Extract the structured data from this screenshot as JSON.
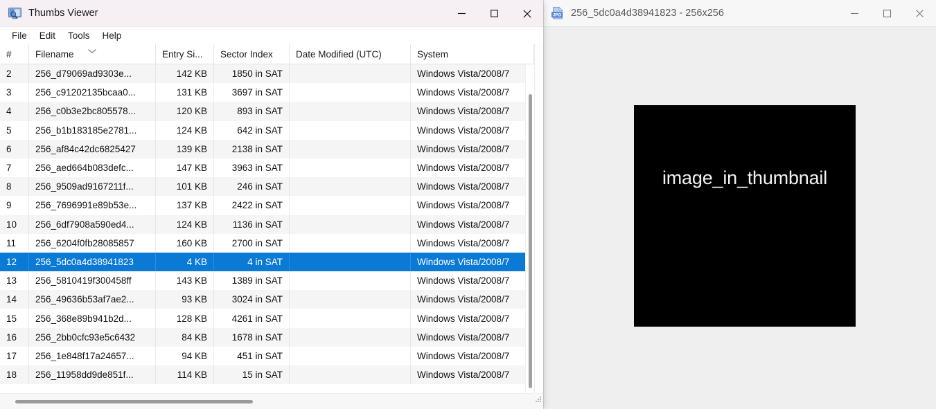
{
  "main_window": {
    "title": "Thumbs Viewer",
    "app_icon": "monitor-magnifier-icon",
    "menu": [
      {
        "label": "File"
      },
      {
        "label": "Edit"
      },
      {
        "label": "Tools"
      },
      {
        "label": "Help"
      }
    ],
    "window_controls": {
      "minimize": "minimize-icon",
      "maximize": "maximize-icon",
      "close": "close-icon"
    },
    "list": {
      "sort_column": "Filename",
      "sort_direction": "descending",
      "selected_row_index": 12,
      "selection_color": "#0b7ad4",
      "columns": [
        {
          "key": "index",
          "label": "#"
        },
        {
          "key": "filename",
          "label": "Filename"
        },
        {
          "key": "entry_size",
          "label": "Entry Si..."
        },
        {
          "key": "sector_index",
          "label": "Sector Index"
        },
        {
          "key": "date_modified",
          "label": "Date Modified (UTC)"
        },
        {
          "key": "system",
          "label": "System"
        }
      ],
      "rows": [
        {
          "index": "2",
          "filename": "256_d79069ad9303e...",
          "entry_size": "142 KB",
          "sector_index": "1850 in SAT",
          "date_modified": "",
          "system": "Windows Vista/2008/7"
        },
        {
          "index": "3",
          "filename": "256_c91202135bcaa0...",
          "entry_size": "131 KB",
          "sector_index": "3697 in SAT",
          "date_modified": "",
          "system": "Windows Vista/2008/7"
        },
        {
          "index": "4",
          "filename": "256_c0b3e2bc805578...",
          "entry_size": "120 KB",
          "sector_index": "893 in SAT",
          "date_modified": "",
          "system": "Windows Vista/2008/7"
        },
        {
          "index": "5",
          "filename": "256_b1b183185e2781...",
          "entry_size": "124 KB",
          "sector_index": "642 in SAT",
          "date_modified": "",
          "system": "Windows Vista/2008/7"
        },
        {
          "index": "6",
          "filename": "256_af84c42dc6825427",
          "entry_size": "139 KB",
          "sector_index": "2138 in SAT",
          "date_modified": "",
          "system": "Windows Vista/2008/7"
        },
        {
          "index": "7",
          "filename": "256_aed664b083defc...",
          "entry_size": "147 KB",
          "sector_index": "3963 in SAT",
          "date_modified": "",
          "system": "Windows Vista/2008/7"
        },
        {
          "index": "8",
          "filename": "256_9509ad9167211f...",
          "entry_size": "101 KB",
          "sector_index": "246 in SAT",
          "date_modified": "",
          "system": "Windows Vista/2008/7"
        },
        {
          "index": "9",
          "filename": "256_7696991e89b53e...",
          "entry_size": "137 KB",
          "sector_index": "2422 in SAT",
          "date_modified": "",
          "system": "Windows Vista/2008/7"
        },
        {
          "index": "10",
          "filename": "256_6df7908a590ed4...",
          "entry_size": "124 KB",
          "sector_index": "1136 in SAT",
          "date_modified": "",
          "system": "Windows Vista/2008/7"
        },
        {
          "index": "11",
          "filename": "256_6204f0fb28085857",
          "entry_size": "160 KB",
          "sector_index": "2700 in SAT",
          "date_modified": "",
          "system": "Windows Vista/2008/7"
        },
        {
          "index": "12",
          "filename": "256_5dc0a4d38941823",
          "entry_size": "4 KB",
          "sector_index": "4 in SAT",
          "date_modified": "",
          "system": "Windows Vista/2008/7"
        },
        {
          "index": "13",
          "filename": "256_5810419f300458ff",
          "entry_size": "143 KB",
          "sector_index": "1389 in SAT",
          "date_modified": "",
          "system": "Windows Vista/2008/7"
        },
        {
          "index": "14",
          "filename": "256_49636b53af7ae2...",
          "entry_size": "93 KB",
          "sector_index": "3024 in SAT",
          "date_modified": "",
          "system": "Windows Vista/2008/7"
        },
        {
          "index": "15",
          "filename": "256_368e89b941b2d...",
          "entry_size": "128 KB",
          "sector_index": "4261 in SAT",
          "date_modified": "",
          "system": "Windows Vista/2008/7"
        },
        {
          "index": "16",
          "filename": "256_2bb0cfc93e5c6432",
          "entry_size": "84 KB",
          "sector_index": "1678 in SAT",
          "date_modified": "",
          "system": "Windows Vista/2008/7"
        },
        {
          "index": "17",
          "filename": "256_1e848f17a24657...",
          "entry_size": "94 KB",
          "sector_index": "451 in SAT",
          "date_modified": "",
          "system": "Windows Vista/2008/7"
        },
        {
          "index": "18",
          "filename": "256_11958dd9de851f...",
          "entry_size": "114 KB",
          "sector_index": "15 in SAT",
          "date_modified": "",
          "system": "Windows Vista/2008/7"
        }
      ]
    }
  },
  "viewer_window": {
    "title": "256_5dc0a4d38941823 - 256x256",
    "file_type_icon": "jpg-file-icon",
    "file_type_label": "JPG",
    "window_controls": {
      "minimize": "minimize-icon",
      "maximize": "maximize-icon",
      "close": "close-icon"
    },
    "preview": {
      "caption": "image_in_thumbnail",
      "background_color": "#000000",
      "text_color": "#f2f2f2",
      "dimensions": "256x256"
    }
  }
}
